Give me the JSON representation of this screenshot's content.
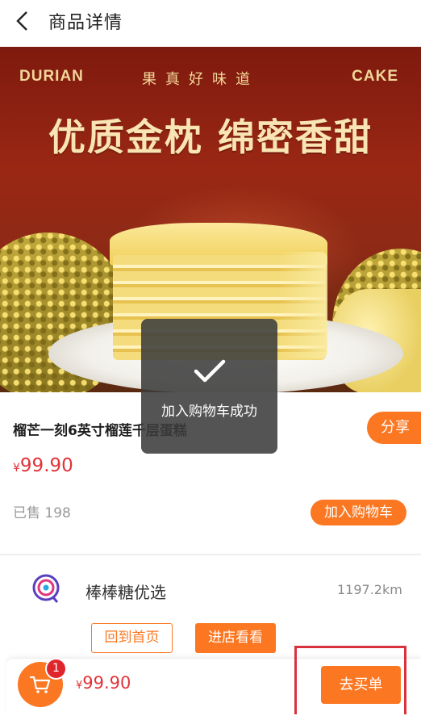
{
  "header": {
    "title": "商品详情"
  },
  "hero": {
    "top_left": "DURIAN",
    "top_middle": "果真好味道",
    "top_right": "CAKE",
    "headline": "优质金枕 绵密香甜"
  },
  "product": {
    "name": "榴芒一刻6英寸榴莲千层蛋糕",
    "share_label": "分享",
    "currency": "¥",
    "price": "99.90",
    "sold_text": "已售 198",
    "add_to_cart_label": "加入购物车"
  },
  "store": {
    "name": "棒棒糖优选",
    "distance": "1197.2km",
    "home_label": "回到首页",
    "visit_label": "进店看看"
  },
  "bottom_bar": {
    "cart_count": "1",
    "currency": "¥",
    "total": "99.90",
    "buy_label": "去买单"
  },
  "toast": {
    "message": "加入购物车成功"
  },
  "colors": {
    "accent": "#fb7722",
    "price": "#e1343a",
    "badge": "#e0262d",
    "highlight": "#d9323d"
  },
  "icons": {
    "back": "chevron-left-icon",
    "cart": "shopping-cart-icon",
    "check": "checkmark-icon",
    "store_logo": "store-logo-icon"
  }
}
